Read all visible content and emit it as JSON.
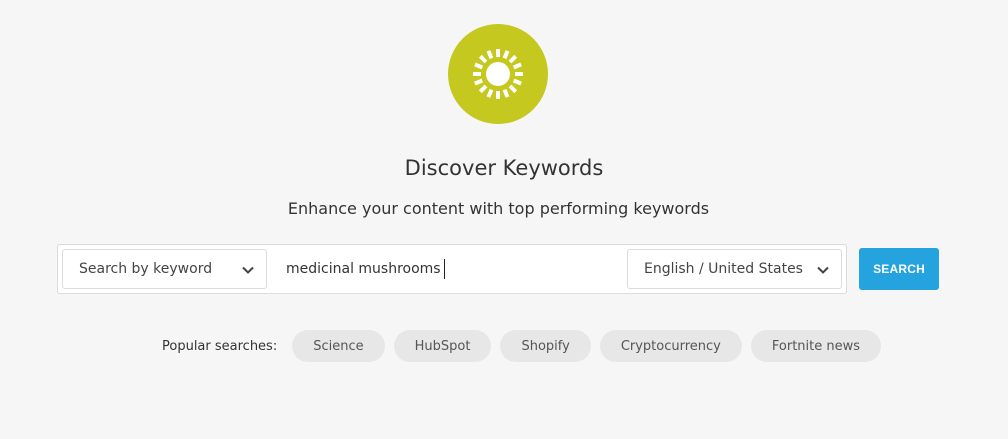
{
  "header": {
    "logo_icon": "sun-icon",
    "logo_color": "#c5c81f",
    "title": "Discover Keywords",
    "subtitle": "Enhance your content with top performing keywords"
  },
  "search": {
    "mode_select": {
      "selected": "Search by keyword",
      "icon": "chevron-down-icon"
    },
    "keyword_value": "medicinal mushrooms",
    "locale_select": {
      "selected": "English / United States",
      "icon": "chevron-down-icon"
    },
    "button_label": "SEARCH",
    "button_color": "#24a3de"
  },
  "popular": {
    "label": "Popular searches:",
    "chips": [
      "Science",
      "HubSpot",
      "Shopify",
      "Cryptocurrency",
      "Fortnite news"
    ]
  }
}
